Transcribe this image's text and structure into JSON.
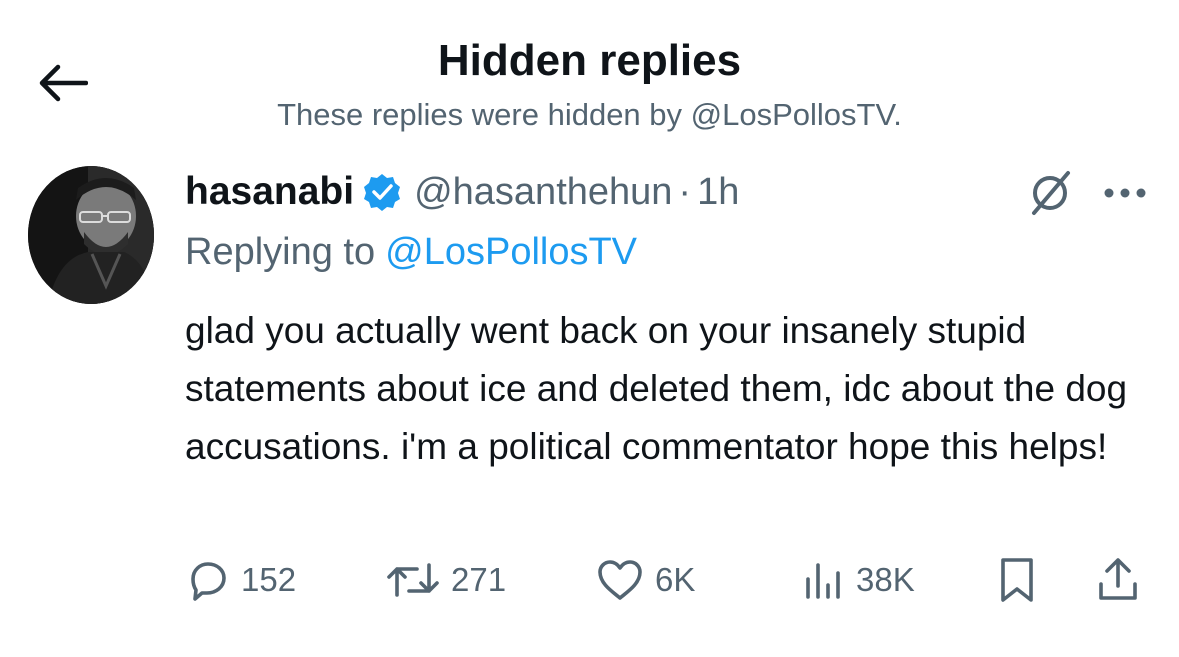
{
  "header": {
    "title": "Hidden replies",
    "subtitle": "These replies were hidden by @LosPollosTV."
  },
  "tweet": {
    "display_name": "hasanabi",
    "handle": "@hasanthehun",
    "separator": "·",
    "time": "1h",
    "replying_prefix": "Replying to",
    "replying_to": "@LosPollosTV",
    "body": "glad you actually went back on your insanely stupid statements about ice and deleted them, idc about the dog accusations. i'm a political commentator hope this helps!",
    "stats": {
      "replies": "152",
      "reposts": "271",
      "likes": "6K",
      "views": "38K"
    }
  },
  "colors": {
    "accent": "#1d9bf0",
    "text": "#0f1419",
    "secondary": "#536471",
    "verified": "#1d9bf0"
  },
  "icons": [
    "back-arrow-icon",
    "verified-badge-icon",
    "hide-reply-icon",
    "more-icon",
    "reply-icon",
    "repost-icon",
    "like-icon",
    "views-icon",
    "bookmark-icon",
    "share-icon"
  ]
}
